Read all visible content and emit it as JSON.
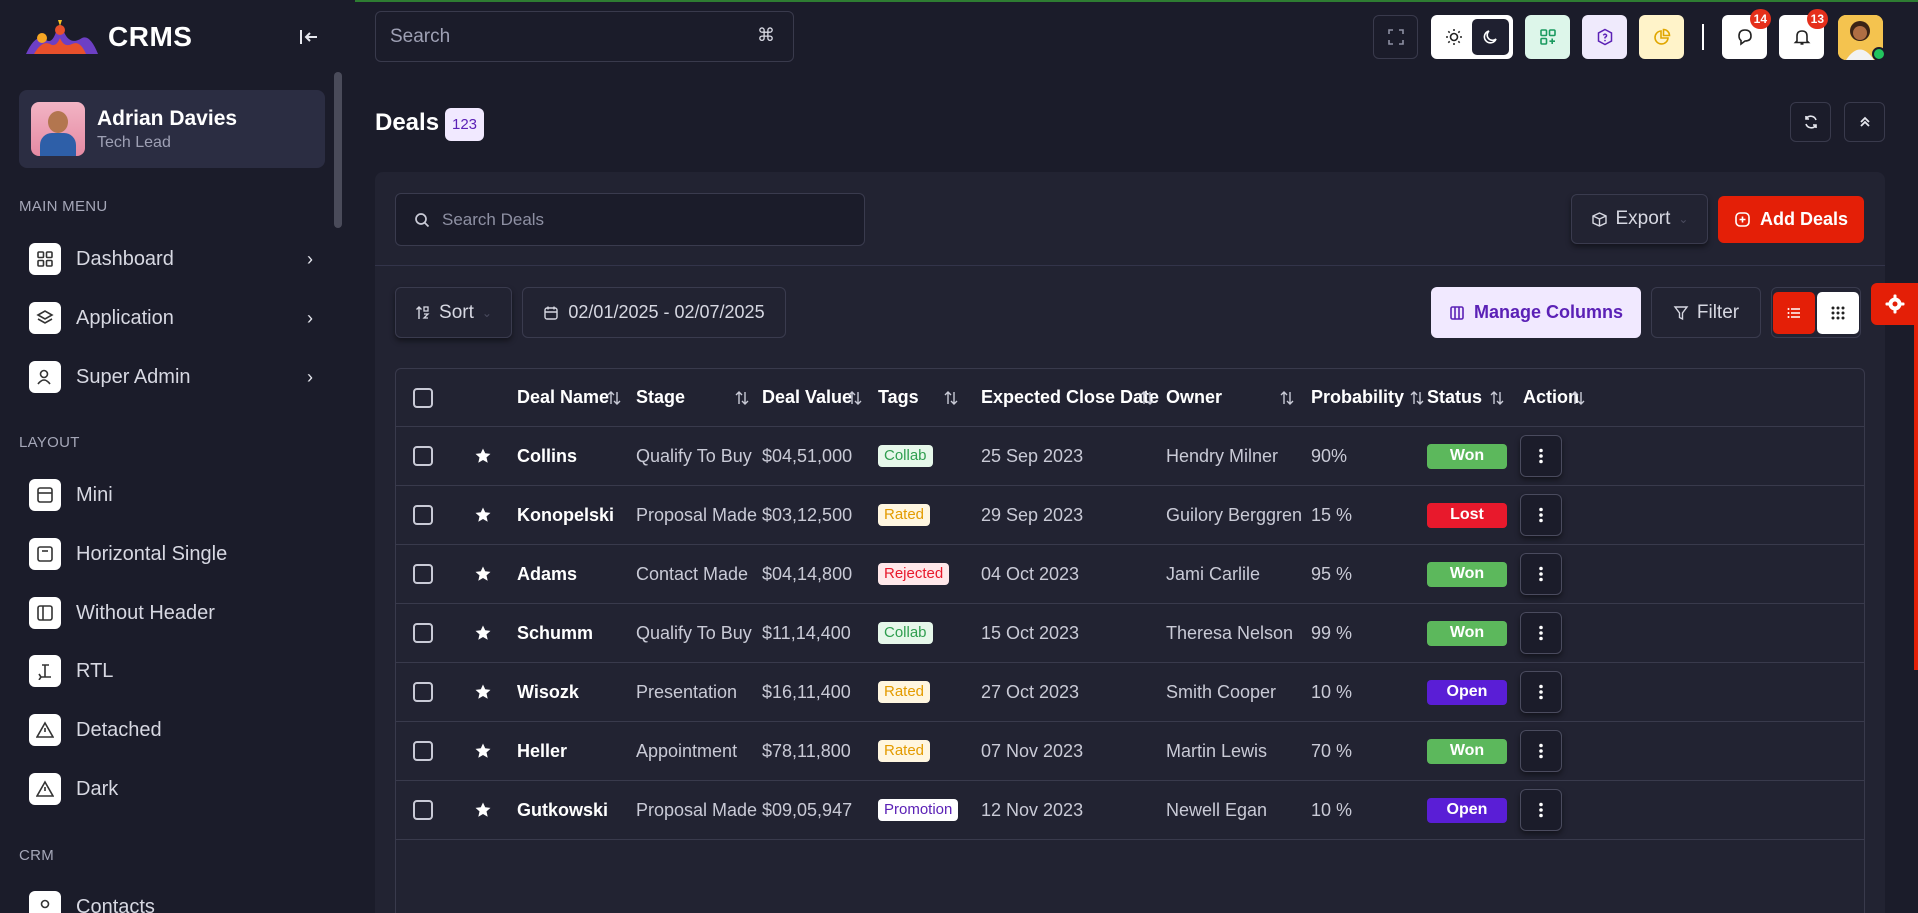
{
  "app": {
    "name": "CRMS"
  },
  "sidebar": {
    "profile": {
      "name": "Adrian Davies",
      "role": "Tech Lead"
    },
    "main_menu_title": "MAIN MENU",
    "main_menu": [
      {
        "label": "Dashboard",
        "icon": "dashboard-icon"
      },
      {
        "label": "Application",
        "icon": "application-icon"
      },
      {
        "label": "Super Admin",
        "icon": "user-admin-icon"
      }
    ],
    "layout_title": "LAYOUT",
    "layout": [
      {
        "label": "Mini",
        "icon": "mini-layout-icon"
      },
      {
        "label": "Horizontal Single",
        "icon": "horizontal-layout-icon"
      },
      {
        "label": "Without Header",
        "icon": "without-header-icon"
      },
      {
        "label": "RTL",
        "icon": "rtl-icon"
      },
      {
        "label": "Detached",
        "icon": "detached-icon"
      },
      {
        "label": "Dark",
        "icon": "dark-icon"
      }
    ],
    "crm_title": "CRM",
    "crm": [
      {
        "label": "Contacts",
        "icon": "contacts-icon"
      }
    ]
  },
  "header": {
    "search_placeholder": "Search",
    "search_shortcut": "⌘",
    "notifications_count": "14",
    "alerts_count": "13"
  },
  "page": {
    "title": "Deals",
    "count": "123",
    "search_placeholder": "Search Deals",
    "export_label": "Export",
    "add_label": "Add Deals",
    "sort_label": "Sort",
    "date_range": "02/01/2025 - 02/07/2025",
    "manage_columns_label": "Manage Columns",
    "filter_label": "Filter"
  },
  "colors": {
    "accent": "#e41f07",
    "won": "#5cb85c",
    "lost": "#e8192c",
    "open": "#5a1ed6"
  },
  "table": {
    "columns": [
      "Deal Name",
      "Stage",
      "Deal Value",
      "Tags",
      "Expected Close Date",
      "Owner",
      "Probability",
      "Status",
      "Action"
    ],
    "rows": [
      {
        "name": "Collins",
        "stage": "Qualify To Buy",
        "value": "$04,51,000",
        "tag": "Collab",
        "date": "25 Sep 2023",
        "owner": "Hendry Milner",
        "probability": "90%",
        "status": "Won"
      },
      {
        "name": "Konopelski",
        "stage": "Proposal Made",
        "value": "$03,12,500",
        "tag": "Rated",
        "date": "29 Sep 2023",
        "owner": "Guilory Berggren",
        "probability": "15 %",
        "status": "Lost"
      },
      {
        "name": "Adams",
        "stage": "Contact Made",
        "value": "$04,14,800",
        "tag": "Rejected",
        "date": "04 Oct 2023",
        "owner": "Jami Carlile",
        "probability": "95 %",
        "status": "Won"
      },
      {
        "name": "Schumm",
        "stage": "Qualify To Buy",
        "value": "$11,14,400",
        "tag": "Collab",
        "date": "15 Oct 2023",
        "owner": "Theresa Nelson",
        "probability": "99 %",
        "status": "Won"
      },
      {
        "name": "Wisozk",
        "stage": "Presentation",
        "value": "$16,11,400",
        "tag": "Rated",
        "date": "27 Oct 2023",
        "owner": "Smith Cooper",
        "probability": "10 %",
        "status": "Open"
      },
      {
        "name": "Heller",
        "stage": "Appointment",
        "value": "$78,11,800",
        "tag": "Rated",
        "date": "07 Nov 2023",
        "owner": "Martin Lewis",
        "probability": "70 %",
        "status": "Won"
      },
      {
        "name": "Gutkowski",
        "stage": "Proposal Made",
        "value": "$09,05,947",
        "tag": "Promotion",
        "date": "12 Nov 2023",
        "owner": "Newell Egan",
        "probability": "10 %",
        "status": "Open"
      }
    ]
  }
}
